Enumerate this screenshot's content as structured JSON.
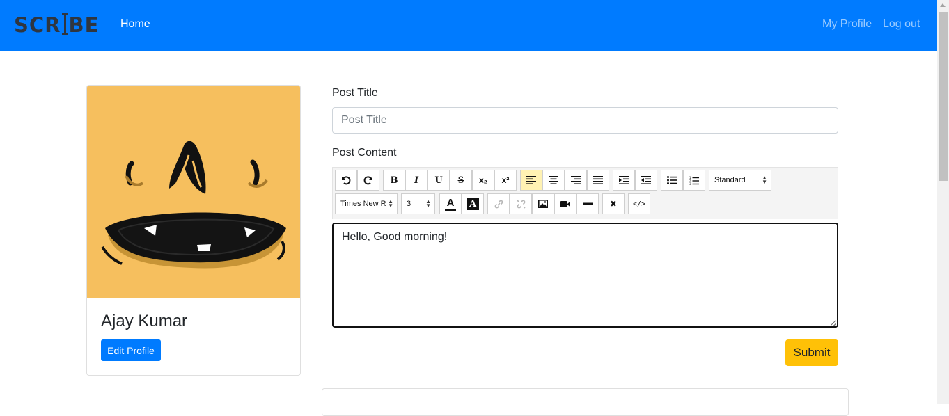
{
  "nav": {
    "brand": "SCRIBE",
    "brand_left": "SCR",
    "brand_right": "BE",
    "home": "Home",
    "my_profile": "My Profile",
    "logout": "Log out"
  },
  "profile": {
    "name": "Ajay Kumar",
    "edit_label": "Edit Profile",
    "avatar_icon": "smiley-face-avatar"
  },
  "form": {
    "title_label": "Post Title",
    "title_placeholder": "Post Title",
    "title_value": "",
    "content_label": "Post Content",
    "content_value": "Hello, Good morning!",
    "submit_label": "Submit"
  },
  "toolbar": {
    "format_select": "Standard",
    "font_select": "Times New R",
    "size_select": "3",
    "buttons": [
      "undo-icon",
      "redo-icon",
      "bold-icon",
      "italic-icon",
      "underline-icon",
      "strikethrough-icon",
      "subscript-icon",
      "superscript-icon",
      "align-left-icon",
      "align-center-icon",
      "align-right-icon",
      "align-justify-icon",
      "indent-icon",
      "outdent-icon",
      "bullet-list-icon",
      "numbered-list-icon",
      "font-color-icon",
      "highlight-color-icon",
      "link-icon",
      "unlink-icon",
      "image-icon",
      "video-icon",
      "horizontal-rule-icon",
      "remove-format-icon",
      "source-code-icon"
    ],
    "glyphs": {
      "bold": "B",
      "italic": "I",
      "underline": "U",
      "strike": "S",
      "subscript": "x₂",
      "superscript": "x²",
      "font_color": "A",
      "highlight": "A",
      "remove_format": "✖",
      "source": "</>"
    },
    "active_button": "align-left-icon",
    "disabled_buttons": [
      "link-icon",
      "unlink-icon"
    ]
  },
  "colors": {
    "navbar": "#007bff",
    "primary_button": "#007bff",
    "submit_button": "#ffc107",
    "avatar_bg": "#f6bf5e",
    "active_tool": "#fff2b3"
  }
}
